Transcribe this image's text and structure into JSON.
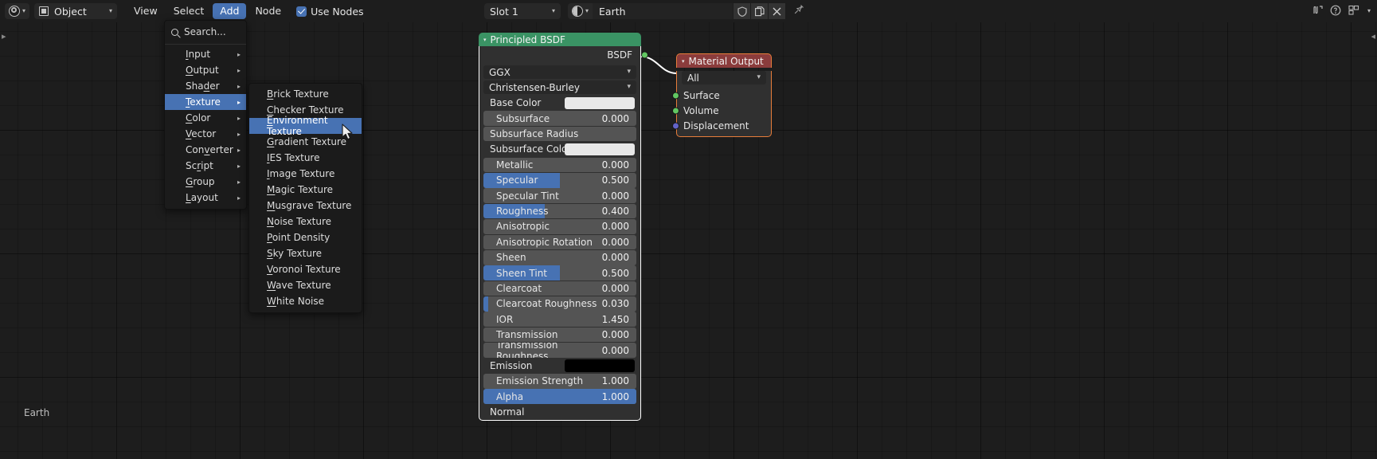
{
  "header": {
    "editor_type_icon": "shader-editor-icon",
    "mode": "Object",
    "menus": [
      "View",
      "Select",
      "Add",
      "Node"
    ],
    "menu_view": "View",
    "menu_select": "Select",
    "menu_add": "Add",
    "menu_node": "Node",
    "use_nodes_label": "Use Nodes",
    "use_nodes_checked": true,
    "slot": "Slot 1",
    "material_name": "Earth",
    "shield_icon": "shield-icon",
    "copy_icon": "copy-icon",
    "close_icon": "x-icon",
    "pin_icon": "pin-icon",
    "accent": "#4772b3"
  },
  "add_menu": {
    "search_label": "Search...",
    "items": [
      {
        "label": "Input",
        "accel": "I",
        "submenu": true,
        "highlight": false
      },
      {
        "label": "Output",
        "accel": "O",
        "submenu": true,
        "highlight": false
      },
      {
        "label": "Shader",
        "accel": "d",
        "submenu": true,
        "highlight": false
      },
      {
        "label": "Texture",
        "accel": "T",
        "submenu": true,
        "highlight": true
      },
      {
        "label": "Color",
        "accel": "C",
        "submenu": true,
        "highlight": false
      },
      {
        "label": "Vector",
        "accel": "V",
        "submenu": true,
        "highlight": false
      },
      {
        "label": "Converter",
        "accel": "v",
        "submenu": true,
        "highlight": false
      },
      {
        "label": "Script",
        "accel": "r",
        "submenu": true,
        "highlight": false
      },
      {
        "label": "Group",
        "accel": "G",
        "submenu": true,
        "highlight": false
      },
      {
        "label": "Layout",
        "accel": "L",
        "submenu": true,
        "highlight": false
      }
    ]
  },
  "texture_submenu": {
    "items": [
      {
        "label": "Brick Texture",
        "highlight": false
      },
      {
        "label": "Checker Texture",
        "highlight": false
      },
      {
        "label": "Environment Texture",
        "highlight": true
      },
      {
        "label": "Gradient Texture",
        "highlight": false
      },
      {
        "label": "IES Texture",
        "highlight": false
      },
      {
        "label": "Image Texture",
        "highlight": false
      },
      {
        "label": "Magic Texture",
        "highlight": false
      },
      {
        "label": "Musgrave Texture",
        "highlight": false
      },
      {
        "label": "Noise Texture",
        "highlight": false
      },
      {
        "label": "Point Density",
        "highlight": false
      },
      {
        "label": "Sky Texture",
        "highlight": false
      },
      {
        "label": "Voronoi Texture",
        "highlight": false
      },
      {
        "label": "Wave Texture",
        "highlight": false
      },
      {
        "label": "White Noise",
        "highlight": false
      }
    ]
  },
  "bsdf_node": {
    "title": "Principled BSDF",
    "header_color": "#3a9364",
    "output_socket": "BSDF",
    "distribution": "GGX",
    "subsurface_method": "Christensen-Burley",
    "properties": [
      {
        "name": "Base Color",
        "type": "color",
        "color": "#e8e8e8",
        "socket": "yellow"
      },
      {
        "name": "Subsurface",
        "type": "slider",
        "value": "0.000",
        "fill": 0,
        "socket": "gray",
        "indent": true
      },
      {
        "name": "Subsurface Radius",
        "type": "vector",
        "value": "",
        "fill": 0,
        "socket": "purple"
      },
      {
        "name": "Subsurface Color",
        "type": "color",
        "color": "#e8e8e8",
        "socket": "yellow"
      },
      {
        "name": "Metallic",
        "type": "slider",
        "value": "0.000",
        "fill": 0,
        "socket": "gray",
        "indent": true
      },
      {
        "name": "Specular",
        "type": "slider",
        "value": "0.500",
        "fill": 50,
        "socket": "gray",
        "indent": true
      },
      {
        "name": "Specular Tint",
        "type": "slider",
        "value": "0.000",
        "fill": 0,
        "socket": "gray",
        "indent": true
      },
      {
        "name": "Roughness",
        "type": "slider",
        "value": "0.400",
        "fill": 40,
        "socket": "gray",
        "indent": true
      },
      {
        "name": "Anisotropic",
        "type": "slider",
        "value": "0.000",
        "fill": 0,
        "socket": "gray",
        "indent": true
      },
      {
        "name": "Anisotropic Rotation",
        "type": "slider",
        "value": "0.000",
        "fill": 0,
        "socket": "gray",
        "indent": true
      },
      {
        "name": "Sheen",
        "type": "slider",
        "value": "0.000",
        "fill": 0,
        "socket": "gray",
        "indent": true
      },
      {
        "name": "Sheen Tint",
        "type": "slider",
        "value": "0.500",
        "fill": 50,
        "socket": "gray",
        "indent": true
      },
      {
        "name": "Clearcoat",
        "type": "slider",
        "value": "0.000",
        "fill": 0,
        "socket": "gray",
        "indent": true
      },
      {
        "name": "Clearcoat Roughness",
        "type": "slider",
        "value": "0.030",
        "fill": 3,
        "socket": "gray",
        "indent": true
      },
      {
        "name": "IOR",
        "type": "slider",
        "value": "1.450",
        "fill": 0,
        "socket": "gray",
        "indent": true
      },
      {
        "name": "Transmission",
        "type": "slider",
        "value": "0.000",
        "fill": 0,
        "socket": "gray",
        "indent": true
      },
      {
        "name": "Transmission Roughness",
        "type": "slider",
        "value": "0.000",
        "fill": 0,
        "socket": "gray",
        "indent": true
      },
      {
        "name": "Emission",
        "type": "color",
        "color": "#000000",
        "socket": "yellow"
      },
      {
        "name": "Emission Strength",
        "type": "slider",
        "value": "1.000",
        "fill": 0,
        "socket": "gray",
        "indent": true
      },
      {
        "name": "Alpha",
        "type": "slider",
        "value": "1.000",
        "fill": 100,
        "socket": "gray",
        "indent": true
      },
      {
        "name": "Normal",
        "type": "socket-only",
        "value": "",
        "fill": 0,
        "socket": "purple"
      }
    ]
  },
  "material_output_node": {
    "title": "Material Output",
    "header_color": "#8b3c3c",
    "border_color": "#e87d3a",
    "target": "All",
    "inputs": [
      {
        "name": "Surface",
        "socket": "green"
      },
      {
        "name": "Volume",
        "socket": "green"
      },
      {
        "name": "Displacement",
        "socket": "purple"
      }
    ]
  },
  "breadcrumb": {
    "label": "Earth"
  }
}
